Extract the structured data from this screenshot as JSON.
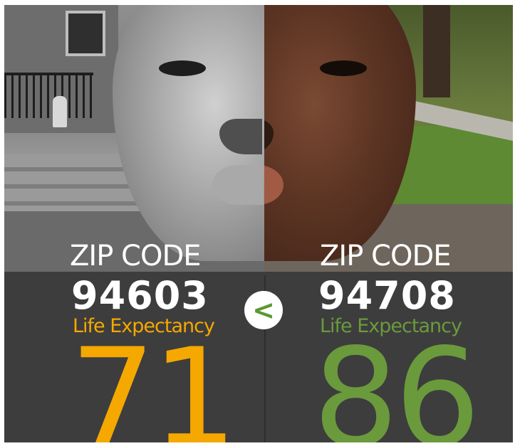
{
  "colors": {
    "left_accent": "#f5a800",
    "right_accent": "#6a9a3c",
    "compare_accent": "#5a9a30",
    "panel_bg": "#3d3d3d"
  },
  "left": {
    "zip_label": "ZIP CODE",
    "zip_code": "94603",
    "life_label": "Life Expectancy",
    "life_expectancy": "71"
  },
  "right": {
    "zip_label": "ZIP CODE",
    "zip_code": "94708",
    "life_label": "Life Expectancy",
    "life_expectancy": "86"
  },
  "comparison": {
    "symbol": "<",
    "icon": "less-than-icon"
  }
}
